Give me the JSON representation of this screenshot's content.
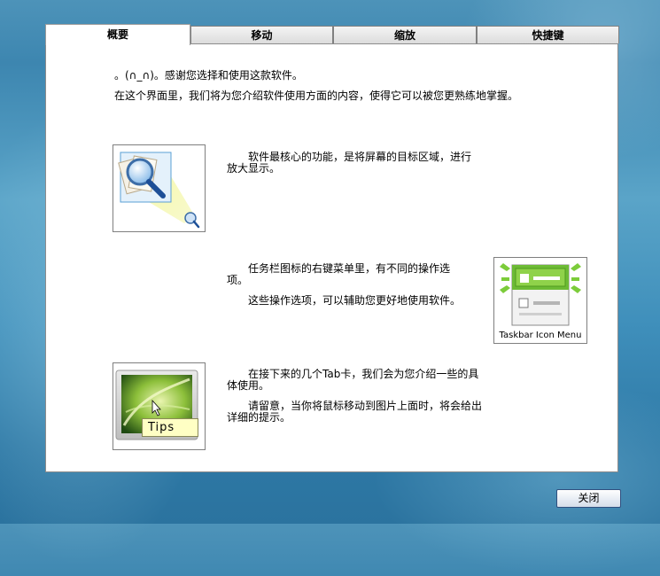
{
  "tabs": [
    {
      "label": "概要"
    },
    {
      "label": "移动"
    },
    {
      "label": "缩放"
    },
    {
      "label": "快捷键"
    }
  ],
  "intro": {
    "line1": "。(∩_∩)。感谢您选择和使用这款软件。",
    "line2": "在这个界面里，我们将为您介绍软件使用方面的内容，使得它可以被您更熟练地掌握。"
  },
  "section1": {
    "text": "软件最核心的功能，是将屏幕的目标区域，进行放大显示。"
  },
  "section2": {
    "text1": "任务栏图标的右键菜单里，有不同的操作选项。",
    "text2": "这些操作选项，可以辅助您更好地使用软件。",
    "image_caption": "Taskbar Icon Menu"
  },
  "section3": {
    "text1": "在接下来的几个Tab卡，我们会为您介绍一些的具体使用。",
    "text2": "请留意，当你将鼠标移动到图片上面时，将会给出详细的提示。",
    "tips_label": "Tips"
  },
  "footer": {
    "close_label": "关闭"
  }
}
